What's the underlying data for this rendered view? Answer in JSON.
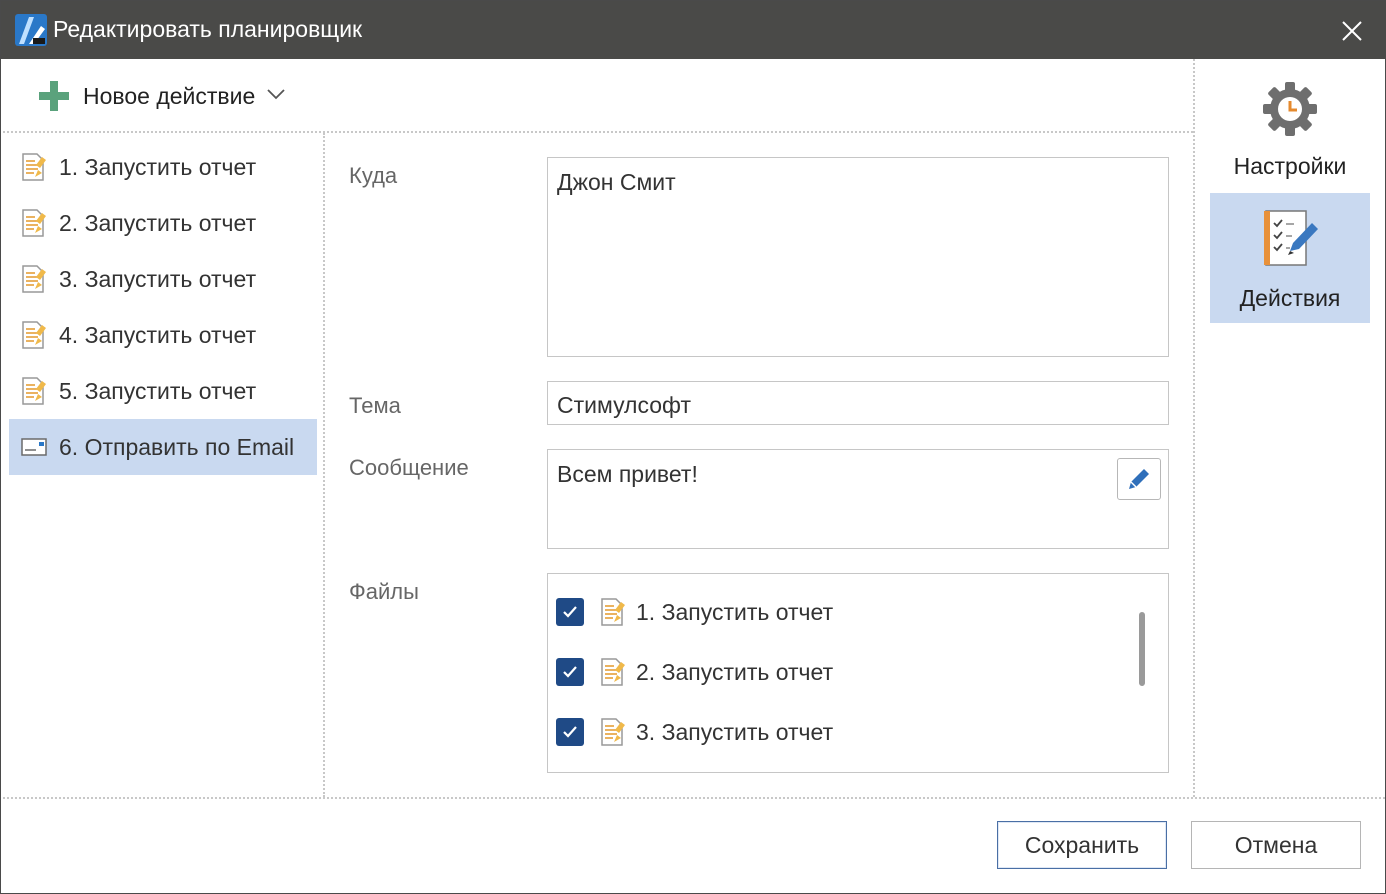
{
  "window": {
    "title": "Редактировать планировщик",
    "colors": {
      "titlebar": "#4a4a48",
      "selection": "#c9d9f0",
      "checkbox": "#1f4a86",
      "add_icon": "#5aa27c"
    }
  },
  "toolbar": {
    "new_action_label": "Новое действие"
  },
  "actions_list": [
    {
      "label": "1. Запустить отчет",
      "icon": "report-icon"
    },
    {
      "label": "2. Запустить отчет",
      "icon": "report-icon"
    },
    {
      "label": "3. Запустить отчет",
      "icon": "report-icon"
    },
    {
      "label": "4. Запустить отчет",
      "icon": "report-icon"
    },
    {
      "label": "5. Запустить отчет",
      "icon": "report-icon"
    },
    {
      "label": "6. Отправить по Email",
      "icon": "email-icon",
      "selected": true
    }
  ],
  "form": {
    "to_label": "Куда",
    "to_value": "Джон Смит",
    "subject_label": "Тема",
    "subject_value": "Стимулсофт",
    "message_label": "Сообщение",
    "message_value": "Всем привет!",
    "files_label": "Файлы",
    "files": [
      {
        "label": "1. Запустить отчет",
        "checked": true
      },
      {
        "label": "2. Запустить отчет",
        "checked": true
      },
      {
        "label": "3. Запустить отчет",
        "checked": true
      }
    ]
  },
  "side_panel": {
    "settings_label": "Настройки",
    "actions_label": "Действия",
    "active": "actions"
  },
  "footer": {
    "save_label": "Сохранить",
    "cancel_label": "Отмена"
  }
}
